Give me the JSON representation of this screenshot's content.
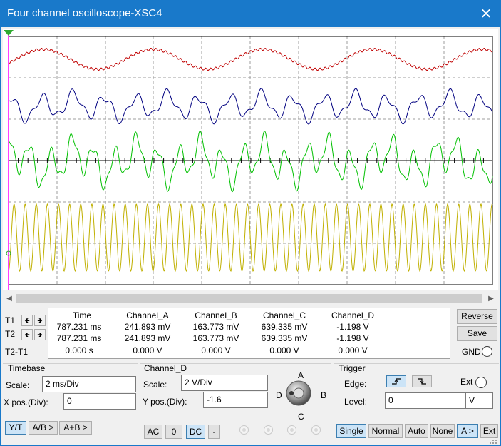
{
  "window": {
    "title": "Four channel oscilloscope-XSC4",
    "close_glyph": "✕"
  },
  "colors": {
    "titlebar": "#1979ca",
    "channel_a": "#c00000",
    "channel_b": "#000080",
    "channel_c": "#00c000",
    "channel_d": "#c0b000",
    "trigger_marker": "#ff00ff",
    "selected_button": "#cce4f7"
  },
  "display": {
    "channels": [
      {
        "id": "A",
        "color": "#c00000",
        "shape": "slow-sine-with-ripple"
      },
      {
        "id": "B",
        "color": "#000080",
        "shape": "distorted-multi-harmonic"
      },
      {
        "id": "C",
        "color": "#00c000",
        "shape": "multi-harmonic-large"
      },
      {
        "id": "D",
        "color": "#c0b000",
        "shape": "high-frequency-sine"
      }
    ]
  },
  "readout": {
    "cursor_labels": [
      "T1",
      "T2",
      "T2-T1"
    ],
    "columns": [
      "Time",
      "Channel_A",
      "Channel_B",
      "Channel_C",
      "Channel_D"
    ],
    "rows": [
      [
        "787.231 ms",
        "241.893 mV",
        "163.773 mV",
        "639.335 mV",
        "-1.198 V"
      ],
      [
        "787.231 ms",
        "241.893 mV",
        "163.773 mV",
        "639.335 mV",
        "-1.198 V"
      ],
      [
        "0.000 s",
        "0.000 V",
        "0.000 V",
        "0.000 V",
        "0.000 V"
      ]
    ],
    "reverse": "Reverse",
    "save": "Save",
    "gnd": "GND"
  },
  "timebase": {
    "title": "Timebase",
    "scale_label": "Scale:",
    "scale_value": "2 ms/Div",
    "xpos_label": "X pos.(Div):",
    "xpos_value": "0",
    "modes": [
      "Y/T",
      "A/B >",
      "A+B >"
    ],
    "active_mode": "Y/T"
  },
  "channel": {
    "title": "Channel_D",
    "scale_label": "Scale:",
    "scale_value": "2  V/Div",
    "ypos_label": "Y pos.(Div):",
    "ypos_value": "-1.6",
    "knob_labels": {
      "a": "A",
      "b": "B",
      "c": "C",
      "d": "D"
    },
    "coupling": [
      "AC",
      "0",
      "DC",
      "-"
    ],
    "active_coupling": "DC"
  },
  "trigger": {
    "title": "Trigger",
    "edge_label": "Edge:",
    "ext_label": "Ext",
    "level_label": "Level:",
    "level_value": "0",
    "level_unit": "V",
    "modes": [
      "Single",
      "Normal",
      "Auto",
      "None",
      "A >",
      "Ext"
    ],
    "active_modes": [
      "Single",
      "A >"
    ],
    "edge_rising_icon": "rising-edge-icon",
    "edge_falling_icon": "falling-edge-icon"
  }
}
